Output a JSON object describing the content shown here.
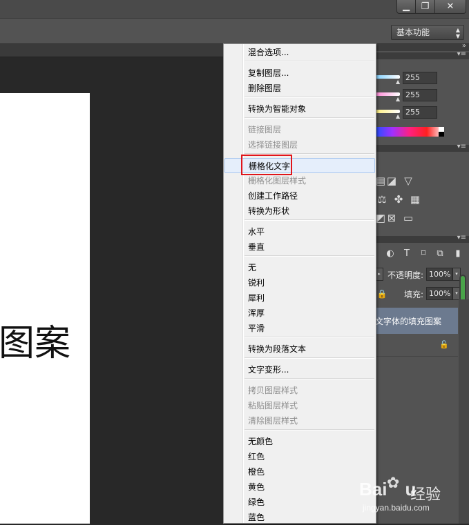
{
  "window": {
    "minimize_icon": "minimize-icon",
    "restore_icon": "restore-icon",
    "close_icon": "close-icon",
    "minimize_glyph": "▁",
    "restore_glyph": "❐",
    "close_glyph": "✕"
  },
  "options_bar": {
    "workspace": "基本功能"
  },
  "canvas": {
    "text": "图案"
  },
  "color_panel": {
    "values": [
      "255",
      "255",
      "255"
    ],
    "slider_colors": [
      "#7fd0ff",
      "#ff86d6",
      "#fff07a"
    ]
  },
  "layers_panel": {
    "opacity_label": "不透明度:",
    "opacity_value": "100%",
    "fill_label": "填充:",
    "fill_value": "100%",
    "layer_name": "文字体的填充图案"
  },
  "context_menu": {
    "items": [
      {
        "label": "混合选项...",
        "disabled": false
      },
      {
        "label": "复制图层...",
        "disabled": false
      },
      {
        "label": "删除图层",
        "disabled": false
      },
      {
        "label": "转换为智能对象",
        "disabled": false
      },
      {
        "label": "链接图层",
        "disabled": true
      },
      {
        "label": "选择链接图层",
        "disabled": true
      },
      {
        "label": "栅格化文字",
        "disabled": false,
        "highlighted": true
      },
      {
        "label": "栅格化图层样式",
        "disabled": true
      },
      {
        "label": "创建工作路径",
        "disabled": false
      },
      {
        "label": "转换为形状",
        "disabled": false
      },
      {
        "label": "水平",
        "disabled": false
      },
      {
        "label": "垂直",
        "disabled": false
      },
      {
        "label": "无",
        "disabled": false
      },
      {
        "label": "锐利",
        "disabled": false
      },
      {
        "label": "犀利",
        "disabled": false
      },
      {
        "label": "浑厚",
        "disabled": false
      },
      {
        "label": "平滑",
        "disabled": false
      },
      {
        "label": "转换为段落文本",
        "disabled": false
      },
      {
        "label": "文字变形...",
        "disabled": false
      },
      {
        "label": "拷贝图层样式",
        "disabled": true
      },
      {
        "label": "粘贴图层样式",
        "disabled": true
      },
      {
        "label": "清除图层样式",
        "disabled": true
      },
      {
        "label": "无颜色",
        "disabled": false
      },
      {
        "label": "红色",
        "disabled": false
      },
      {
        "label": "橙色",
        "disabled": false
      },
      {
        "label": "黄色",
        "disabled": false
      },
      {
        "label": "绿色",
        "disabled": false
      },
      {
        "label": "蓝色",
        "disabled": false
      }
    ]
  },
  "watermark": {
    "logo": "Bai",
    "logo_tail": "u",
    "cn": "经验",
    "url": "jingyan.baidu.com"
  },
  "colors": {
    "highlight_box": "#e0151a",
    "selected_layer": "#6c7a8f",
    "menu_bg": "#f0f0f0"
  }
}
